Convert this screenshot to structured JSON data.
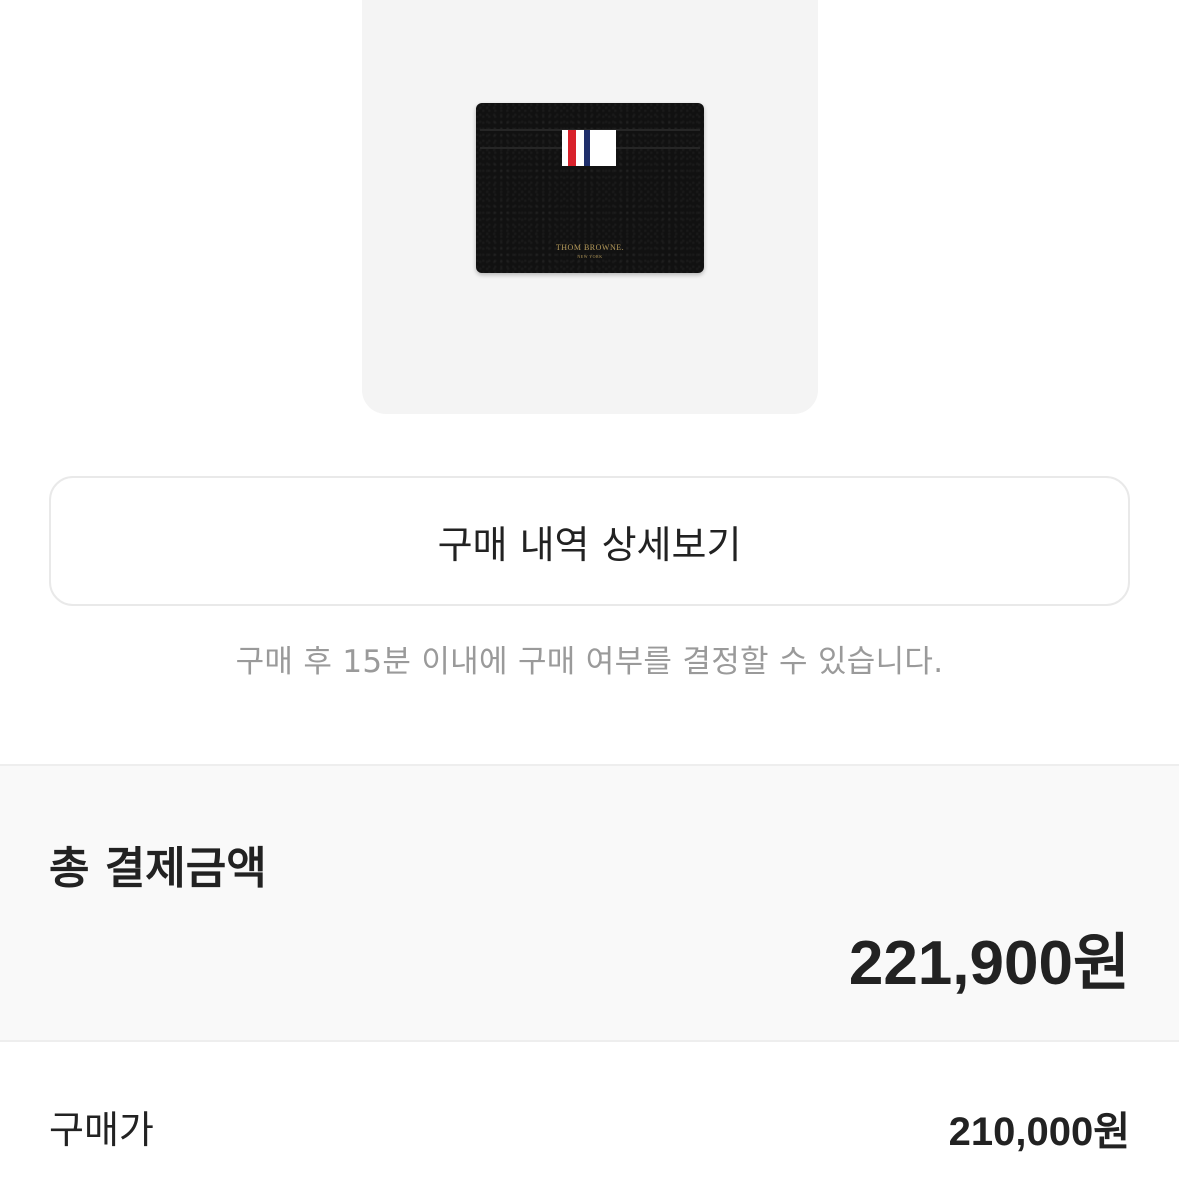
{
  "product": {
    "image_alt": "product-image",
    "brand_text": "THOM BROWNE.",
    "brand_subtext": "NEW YORK",
    "stripe_colors": [
      "#ffffff",
      "#d8212b",
      "#ffffff",
      "#1f2f6b",
      "#ffffff"
    ]
  },
  "detail_button": {
    "label": "구매 내역 상세보기"
  },
  "notice": {
    "text": "구매 후 15분 이내에 구매 여부를 결정할 수 있습니다."
  },
  "total": {
    "label": "총 결제금액",
    "amount": "221,900원"
  },
  "price_row": {
    "label": "구매가",
    "value": "210,000원"
  }
}
